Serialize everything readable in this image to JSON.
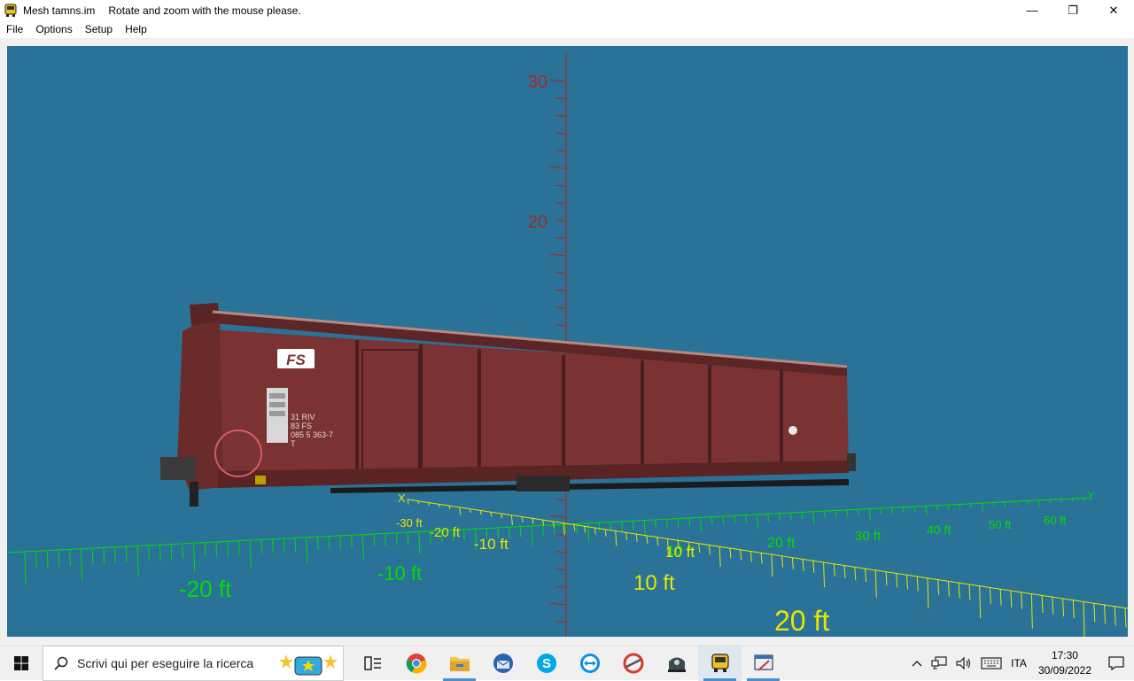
{
  "window": {
    "title": "Mesh tamns.im",
    "subtitle": "Rotate and zoom with the mouse please.",
    "minimize_glyph": "—",
    "restore_glyph": "❐",
    "close_glyph": "✕"
  },
  "menu": {
    "items": [
      {
        "label": "File"
      },
      {
        "label": "Options"
      },
      {
        "label": "Setup"
      },
      {
        "label": "Help"
      }
    ]
  },
  "viewport": {
    "background": "#2a7298",
    "z_axis": {
      "color": "#a52a2a",
      "labels": [
        "30",
        "20"
      ]
    },
    "y_axis": {
      "color": "#00dd00",
      "label": "Y",
      "tick_labels": [
        "-20 ft",
        "-10 ft",
        "10 ft",
        "20 ft",
        "30 ft",
        "40 ft",
        "50 ft",
        "60 ft"
      ]
    },
    "x_axis": {
      "color": "#e6e600",
      "label": "X",
      "tick_labels": [
        "-30 ft",
        "-20 ft",
        "-10 ft",
        "10 ft",
        "10 ft",
        "20 ft"
      ]
    },
    "wagon": {
      "body_color": "#7a3332",
      "markings": [
        "FS",
        "31  RIV",
        "83  FS",
        "085 5 363-7",
        "T"
      ]
    }
  },
  "taskbar": {
    "search_placeholder": "Scrivi qui per eseguire la ricerca",
    "apps": [
      {
        "name": "task-view"
      },
      {
        "name": "chrome"
      },
      {
        "name": "file-explorer"
      },
      {
        "name": "thunderbird"
      },
      {
        "name": "skype"
      },
      {
        "name": "teamviewer"
      },
      {
        "name": "ccleaner"
      },
      {
        "name": "locomotive"
      },
      {
        "name": "train-sim"
      },
      {
        "name": "editor"
      }
    ],
    "tray": {
      "language": "ITA",
      "time": "17:30",
      "date": "30/09/2022"
    }
  }
}
